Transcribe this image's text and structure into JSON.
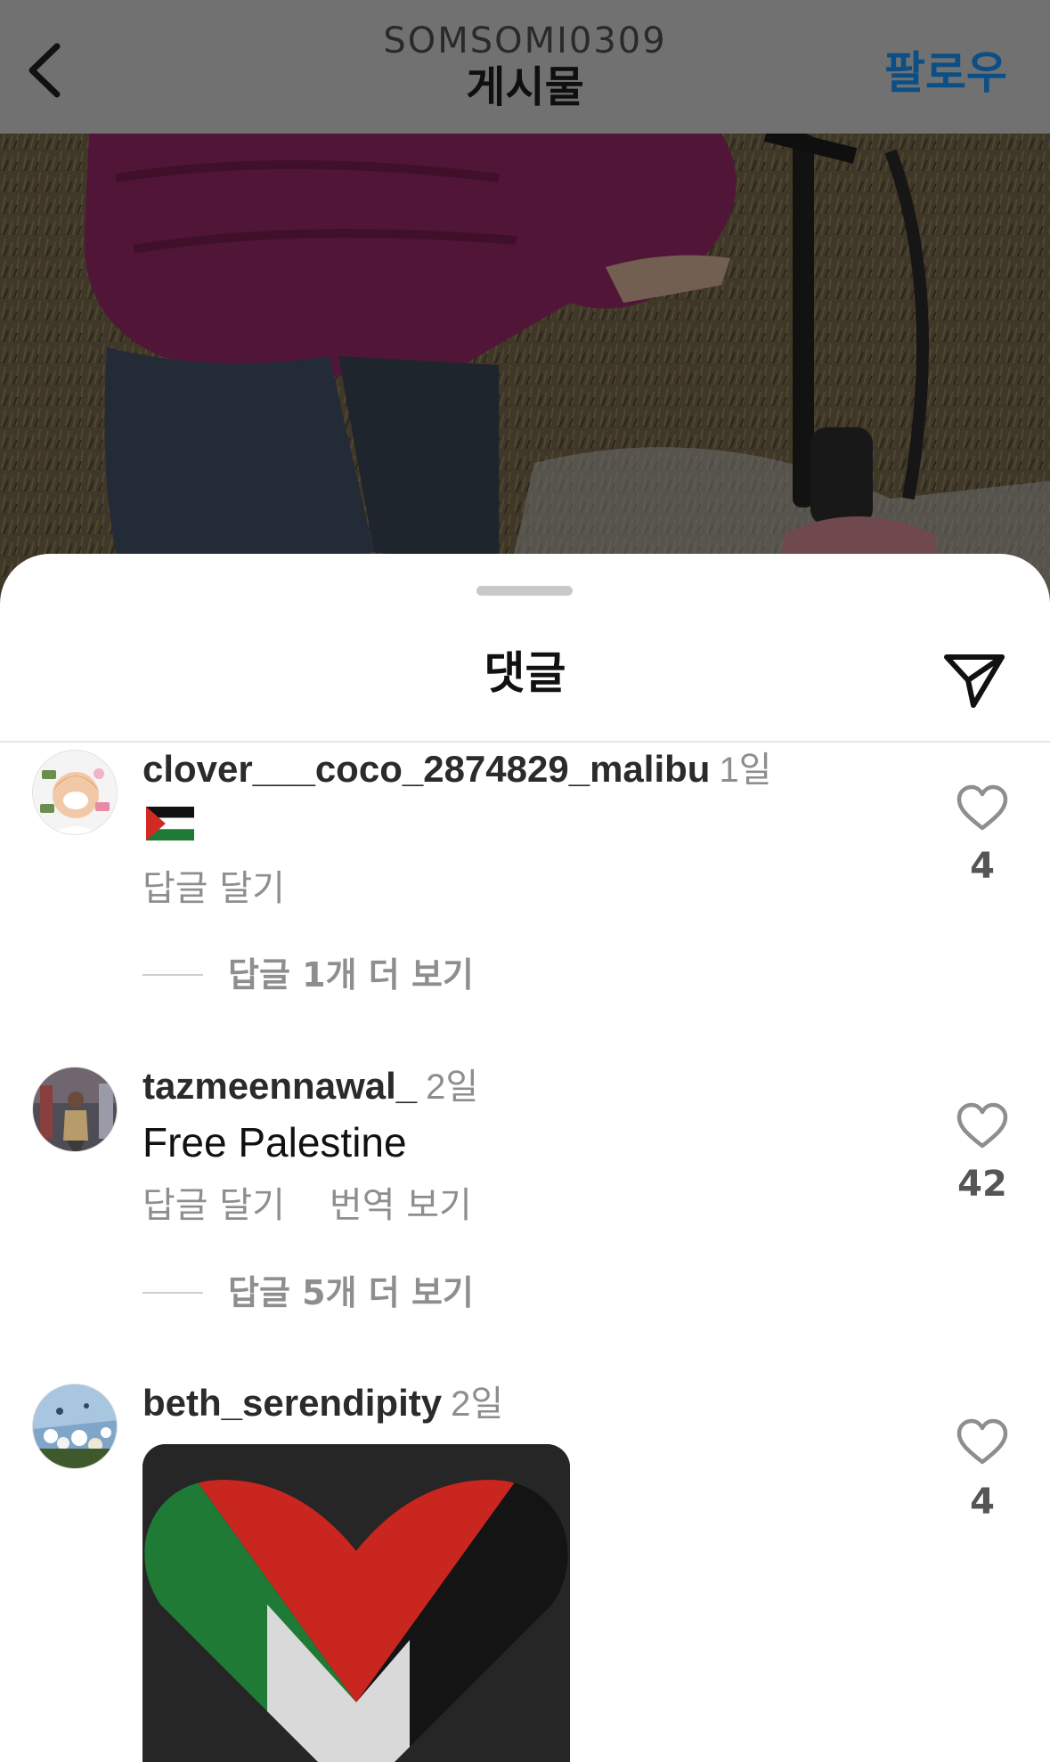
{
  "header": {
    "username": "SOMSOMI0309",
    "title": "게시물",
    "follow_label": "팔로우"
  },
  "sheet": {
    "title": "댓글"
  },
  "comments": [
    {
      "username": "clover___coco_2874829_malibu",
      "time": "1일",
      "emoji": "palestine-flag",
      "actions": [
        "답글 달기"
      ],
      "likes": "4",
      "more_replies": "답글 1개 더 보기"
    },
    {
      "username": "tazmeennawal_",
      "time": "2일",
      "text": "Free Palestine",
      "actions": [
        "답글 달기",
        "번역 보기"
      ],
      "likes": "42",
      "more_replies": "답글 5개 더 보기"
    },
    {
      "username": "beth_serendipity",
      "time": "2일",
      "image": "palestine-flag-heart",
      "likes": "4"
    }
  ],
  "icons": {
    "back": "chevron-left-icon",
    "share": "send-icon",
    "like": "heart-icon"
  },
  "colors": {
    "follow": "#0c4f86",
    "secondary_text": "#8e8e8e",
    "flag_green": "#1f7a35",
    "flag_red": "#c8261f"
  }
}
